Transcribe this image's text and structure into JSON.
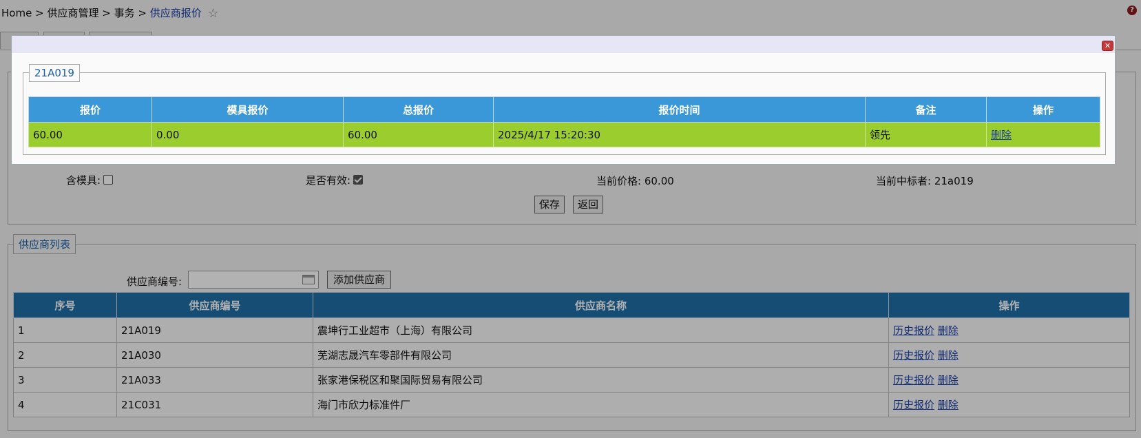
{
  "breadcrumb": {
    "home": "Home",
    "sep": ">",
    "level1": "供应商管理",
    "level2": "事务",
    "current": "供应商报价",
    "star_icon": "star-icon"
  },
  "form": {
    "mold_label": "含模具:",
    "mold_checked": false,
    "valid_label": "是否有效:",
    "valid_checked": true,
    "current_price_label": "当前价格:",
    "current_price_value": "60.00",
    "current_winner_label": "当前中标者:",
    "current_winner_value": "21a019",
    "save_button": "保存",
    "back_button": "返回"
  },
  "supplier_list": {
    "legend": "供应商列表",
    "search_label": "供应商编号:",
    "search_value": "",
    "add_button": "添加供应商",
    "columns": [
      "序号",
      "供应商编号",
      "供应商名称",
      "操作"
    ],
    "rows": [
      {
        "index": "1",
        "code": "21A019",
        "name": "震坤行工业超市（上海）有限公司",
        "history": "历史报价",
        "delete": "删除"
      },
      {
        "index": "2",
        "code": "21A030",
        "name": "芜湖志晟汽车零部件有限公司",
        "history": "历史报价",
        "delete": "删除"
      },
      {
        "index": "3",
        "code": "21A033",
        "name": "张家港保税区和聚国际贸易有限公司",
        "history": "历史报价",
        "delete": "删除"
      },
      {
        "index": "4",
        "code": "21C031",
        "name": "海门市欣力标准件厂",
        "history": "历史报价",
        "delete": "删除"
      }
    ]
  },
  "modal": {
    "legend": "21A019",
    "close_icon": "close-icon",
    "columns": [
      "报价",
      "模具报价",
      "总报价",
      "报价时间",
      "备注",
      "操作"
    ],
    "rows": [
      {
        "price": "60.00",
        "mold_price": "0.00",
        "total": "60.00",
        "time": "2025/4/17 15:20:30",
        "note": "领先",
        "action": "删除"
      }
    ]
  },
  "colors": {
    "modal_header": "#3a98d8",
    "highlight_row": "#9ccd2f",
    "table_header": "#1f6fa8",
    "link": "#1a3fa8",
    "close_button": "#c6393a"
  }
}
